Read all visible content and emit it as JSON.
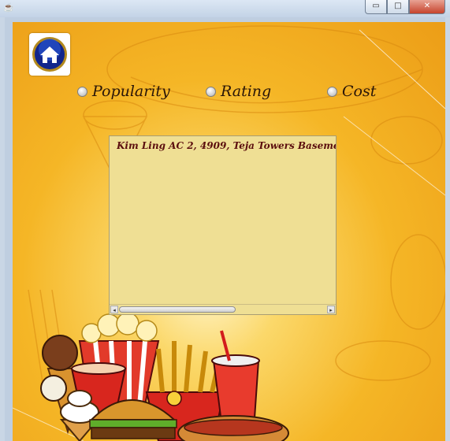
{
  "window": {
    "app_icon": "java-cup-icon",
    "buttons": {
      "minimize": "▭",
      "maximize": "□",
      "close": "✕"
    }
  },
  "home_button": {
    "icon": "home-icon"
  },
  "sort_options": [
    {
      "label": "Popularity",
      "selected": false
    },
    {
      "label": "Rating",
      "selected": false
    },
    {
      "label": "Cost",
      "selected": false
    }
  ],
  "result_area": {
    "text": "Kim Ling AC 2, 4909, Teja Towers Baseme",
    "scrollbar": {
      "left_arrow": "◂",
      "right_arrow": "▸"
    }
  },
  "colors": {
    "background": "#f5b626",
    "text_area": "#efdf94",
    "result_text": "#5b0e0e"
  }
}
